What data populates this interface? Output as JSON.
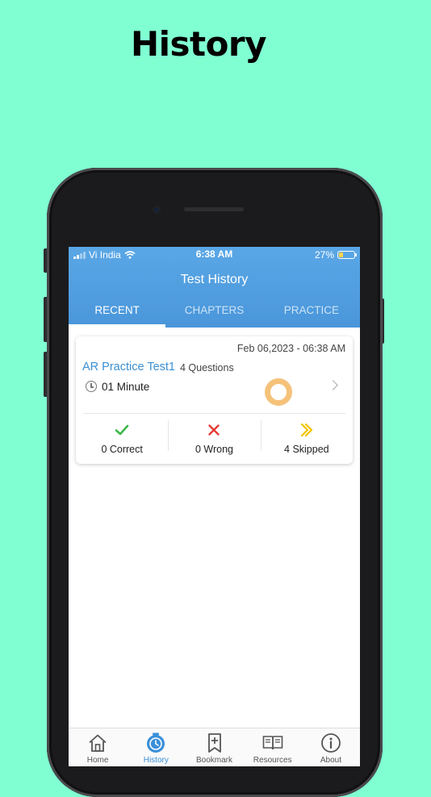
{
  "page_heading": "History",
  "status_bar": {
    "carrier": "Vi India",
    "time": "6:38 AM",
    "battery_text": "27%",
    "battery_level": 0.27
  },
  "header": {
    "title": "Test History",
    "tabs": [
      {
        "label": "RECENT",
        "active": true
      },
      {
        "label": "CHAPTERS",
        "active": false
      },
      {
        "label": "PRACTICE",
        "active": false
      }
    ]
  },
  "history_items": [
    {
      "date": "Feb 06,2023 - 06:38 AM",
      "title": "AR Practice Test1",
      "questions": "4 Questions",
      "duration": "01 Minute",
      "correct_label": "0 Correct",
      "wrong_label": "0 Wrong",
      "skipped_label": "4 Skipped"
    }
  ],
  "bottom_nav": [
    {
      "label": "Home",
      "icon": "home-icon",
      "active": false
    },
    {
      "label": "History",
      "icon": "history-icon",
      "active": true
    },
    {
      "label": "Bookmark",
      "icon": "bookmark-icon",
      "active": false
    },
    {
      "label": "Resources",
      "icon": "book-icon",
      "active": false
    },
    {
      "label": "About",
      "icon": "info-icon",
      "active": false
    }
  ],
  "colors": {
    "background": "#80ffd2",
    "header": "#4a96da",
    "accent": "#3a8fd9",
    "correct": "#3db84a",
    "wrong": "#e53935",
    "skipped": "#f2c300",
    "progress": "#f5c27a"
  }
}
